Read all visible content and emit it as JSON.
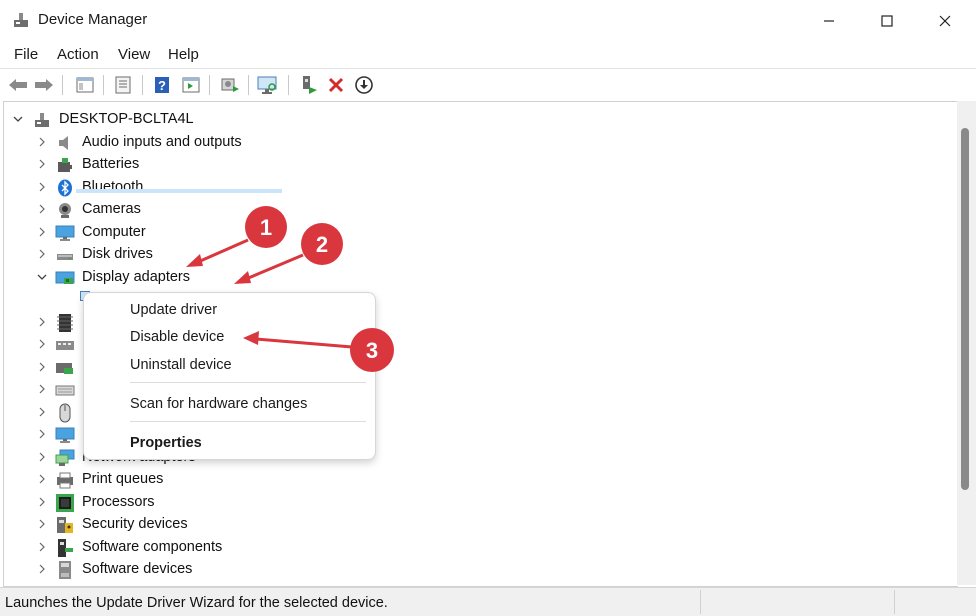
{
  "window": {
    "title": "Device Manager",
    "buttons": {
      "minimize": "minimize",
      "maximize": "maximize",
      "close": "close"
    }
  },
  "menu": {
    "items": [
      "File",
      "Action",
      "View",
      "Help"
    ]
  },
  "toolbar": {
    "buttons": [
      "back-arrow-icon",
      "forward-arrow-icon",
      "show-hide-tree-icon",
      "properties-icon",
      "help-icon",
      "action-pane-icon",
      "update-driver-icon",
      "scan-hardware-icon",
      "enable-device-icon",
      "uninstall-device-icon",
      "disable-device-icon"
    ]
  },
  "tree": {
    "root": "DESKTOP-BCLTA4L",
    "categories": [
      {
        "label": "Audio inputs and outputs",
        "icon": "speaker-icon",
        "expanded": false
      },
      {
        "label": "Batteries",
        "icon": "battery-icon",
        "expanded": false
      },
      {
        "label": "Bluetooth",
        "icon": "bluetooth-icon",
        "expanded": false
      },
      {
        "label": "Cameras",
        "icon": "camera-icon",
        "expanded": false
      },
      {
        "label": "Computer",
        "icon": "monitor-icon",
        "expanded": false
      },
      {
        "label": "Disk drives",
        "icon": "disk-drive-icon",
        "expanded": false
      },
      {
        "label": "Display adapters",
        "icon": "display-adapter-icon",
        "expanded": true
      },
      {
        "label": "",
        "icon": "chip-icon",
        "expanded": false
      },
      {
        "label": "",
        "icon": "hid-icon",
        "expanded": false
      },
      {
        "label": "",
        "icon": "ide-icon",
        "expanded": false
      },
      {
        "label": "",
        "icon": "keyboard-icon",
        "expanded": false
      },
      {
        "label": "",
        "icon": "mouse-icon",
        "expanded": false
      },
      {
        "label": "",
        "icon": "monitor-icon",
        "expanded": false
      },
      {
        "label": "Network adapters",
        "icon": "network-icon",
        "expanded": false
      },
      {
        "label": "Print queues",
        "icon": "printer-icon",
        "expanded": false
      },
      {
        "label": "Processors",
        "icon": "processor-icon",
        "expanded": false
      },
      {
        "label": "Security devices",
        "icon": "security-device-icon",
        "expanded": false
      },
      {
        "label": "Software components",
        "icon": "software-component-icon",
        "expanded": false
      },
      {
        "label": "Software devices",
        "icon": "software-device-icon",
        "expanded": false
      }
    ]
  },
  "context_menu": {
    "update_driver": "Update driver",
    "disable_device": "Disable device",
    "uninstall_device": "Uninstall device",
    "scan_hardware": "Scan for hardware changes",
    "properties": "Properties"
  },
  "callouts": [
    "1",
    "2",
    "3"
  ],
  "status": {
    "text": "Launches the Update Driver Wizard for the selected device."
  },
  "colors": {
    "callout": "#d9363e",
    "selection": "#cce4f7",
    "accent": "#1e73d2"
  }
}
